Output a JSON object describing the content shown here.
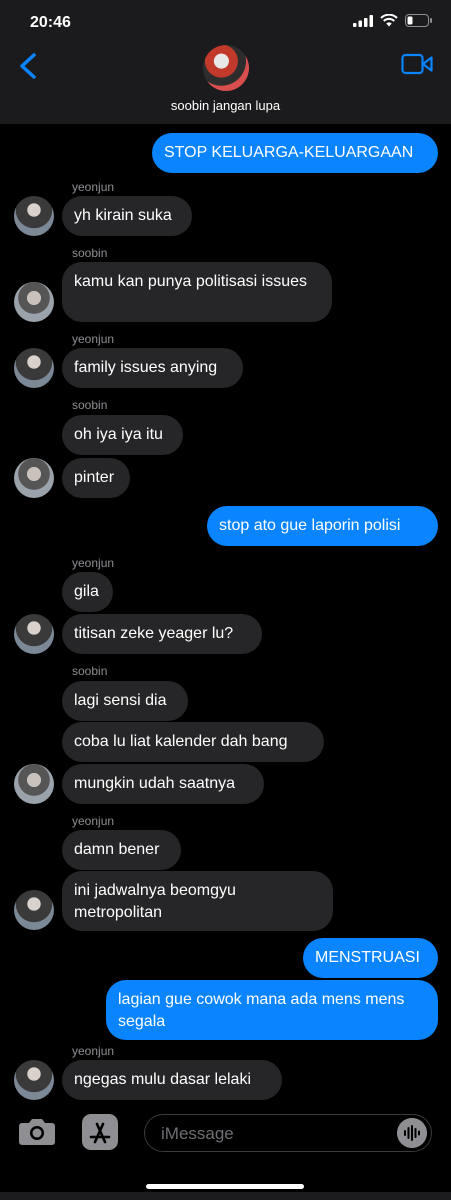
{
  "status_bar": {
    "time": "20:46"
  },
  "header": {
    "contact_name": "soobin jangan lupa"
  },
  "messages": [
    {
      "text": "STOP KELUARGA-KELUARGAAN"
    },
    {
      "sender": "yeonjun",
      "text": "yh kirain suka"
    },
    {
      "sender": "soobin",
      "text": "kamu kan punya politisasi issues"
    },
    {
      "sender": "yeonjun",
      "text": "family issues anying"
    },
    {
      "sender": "soobin",
      "text": "oh iya iya itu"
    },
    {
      "text": "pinter"
    },
    {
      "text": "stop ato gue laporin polisi"
    },
    {
      "sender": "yeonjun",
      "text": "gila"
    },
    {
      "text": "titisan zeke yeager lu?"
    },
    {
      "sender": "soobin",
      "text": "lagi sensi dia"
    },
    {
      "text": "coba lu liat kalender dah bang"
    },
    {
      "text": "mungkin udah saatnya"
    },
    {
      "sender": "yeonjun",
      "text": "damn bener"
    },
    {
      "text": "ini jadwalnya beomgyu metropolitan"
    },
    {
      "text": "MENSTRUASI"
    },
    {
      "text": "lagian gue cowok mana ada mens mens segala"
    },
    {
      "sender": "yeonjun",
      "text": "ngegas mulu dasar lelaki"
    }
  ],
  "input": {
    "placeholder": "iMessage"
  },
  "icons": [
    "back-chevron-icon",
    "video-call-icon",
    "camera-icon",
    "app-store-icon",
    "voice-memo-icon"
  ],
  "colors": {
    "outgoing_bubble": "#0a84ff",
    "incoming_bubble": "#262628",
    "background": "#000000"
  }
}
